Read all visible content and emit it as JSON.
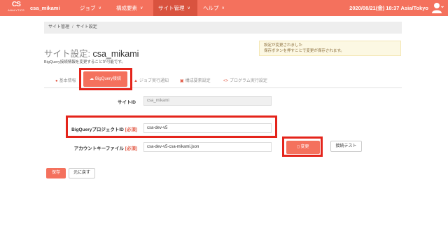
{
  "header": {
    "logo_mark": "CS",
    "logo_word": "ANALYTICS",
    "account": "csa_mikami",
    "nav": [
      {
        "label": "ジョブ"
      },
      {
        "label": "構成要素"
      },
      {
        "label": "サイト管理"
      },
      {
        "label": "ヘルプ"
      }
    ],
    "datetime": "2020/08/21(金) 18:37 Asia/Tokyo",
    "nav_color": "#f4715d",
    "active_nav_color": "#d9533f"
  },
  "breadcrumb": {
    "parent": "サイト管理",
    "separator": "/",
    "current": "サイト設定"
  },
  "page": {
    "title_prefix": "サイト設定:",
    "title_name": "csa_mikami",
    "subtitle": "BigQuery接続情報を変更することが可能です。"
  },
  "notice": {
    "line1": "設定が変更されました",
    "line2": "保存ボタンを押すことで変更が保存されます。"
  },
  "tabs": [
    {
      "label": "基本情報",
      "icon": "info-icon"
    },
    {
      "label": "BigQuery接続",
      "icon": "cloud-icon",
      "active": true
    },
    {
      "label": "ジョブ実行通知",
      "icon": "bell-icon"
    },
    {
      "label": "構成要素設定",
      "icon": "gear-box-icon"
    },
    {
      "label": "プログラム実行設定",
      "icon": "code-icon"
    }
  ],
  "form": {
    "site_id_label": "サイトID",
    "site_id_value": "csa_mikami",
    "project_label": "BigQueryプロジェクトID",
    "project_value": "csa-dev-v5",
    "key_label": "アカウントキーファイル",
    "key_value": "csa-dev-v5-csa-mikami.json",
    "required": "[必須]",
    "change_button": "変更",
    "test_button": "接続テスト"
  },
  "actions": {
    "save": "保存",
    "back": "元に戻す"
  },
  "highlight_color": "#e4241b"
}
